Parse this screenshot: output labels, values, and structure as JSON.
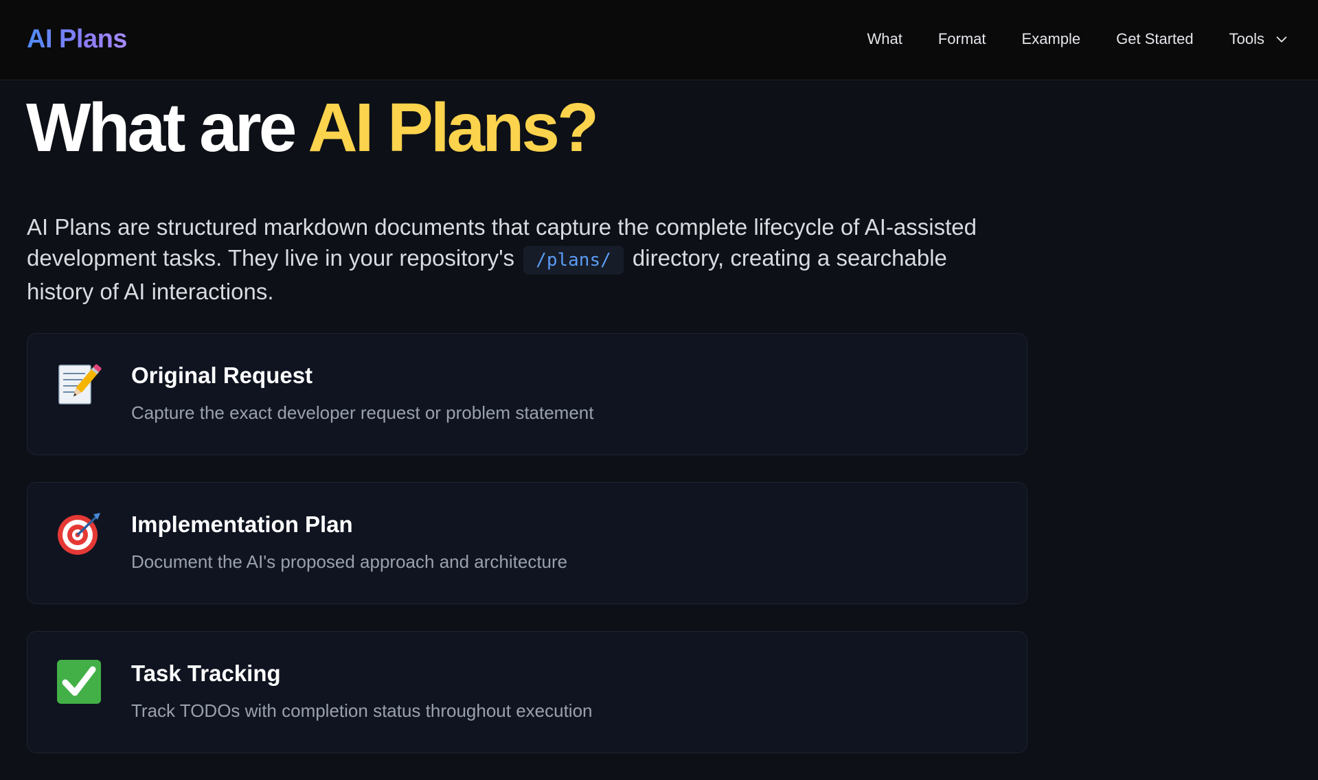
{
  "header": {
    "brand": "AI Plans",
    "nav": [
      {
        "label": "What"
      },
      {
        "label": "Format"
      },
      {
        "label": "Example"
      },
      {
        "label": "Get Started"
      },
      {
        "label": "Tools"
      }
    ]
  },
  "hero": {
    "title_part1": "What are ",
    "title_part2": "AI Plans?",
    "intro_before": "AI Plans are structured markdown documents that capture the complete lifecycle of AI-assisted development tasks. They live in your repository's ",
    "intro_code": "/plans/",
    "intro_after": " directory, creating a searchable history of AI interactions."
  },
  "cards": [
    {
      "icon": "memo-icon",
      "title": "Original Request",
      "description": "Capture the exact developer request or problem statement"
    },
    {
      "icon": "target-icon",
      "title": "Implementation Plan",
      "description": "Document the AI's proposed approach and architecture"
    },
    {
      "icon": "check-mark-icon",
      "title": "Task Tracking",
      "description": "Track TODOs with completion status throughout execution"
    }
  ],
  "colors": {
    "background": "#0d1016",
    "header_bg": "#0a0a0b",
    "accent_yellow": "#fcd34d",
    "brand_gradient_start": "#4f8cf7",
    "brand_gradient_end": "#a78bfa",
    "code_text": "#5b9cf5",
    "card_bg": "#0f1420"
  }
}
